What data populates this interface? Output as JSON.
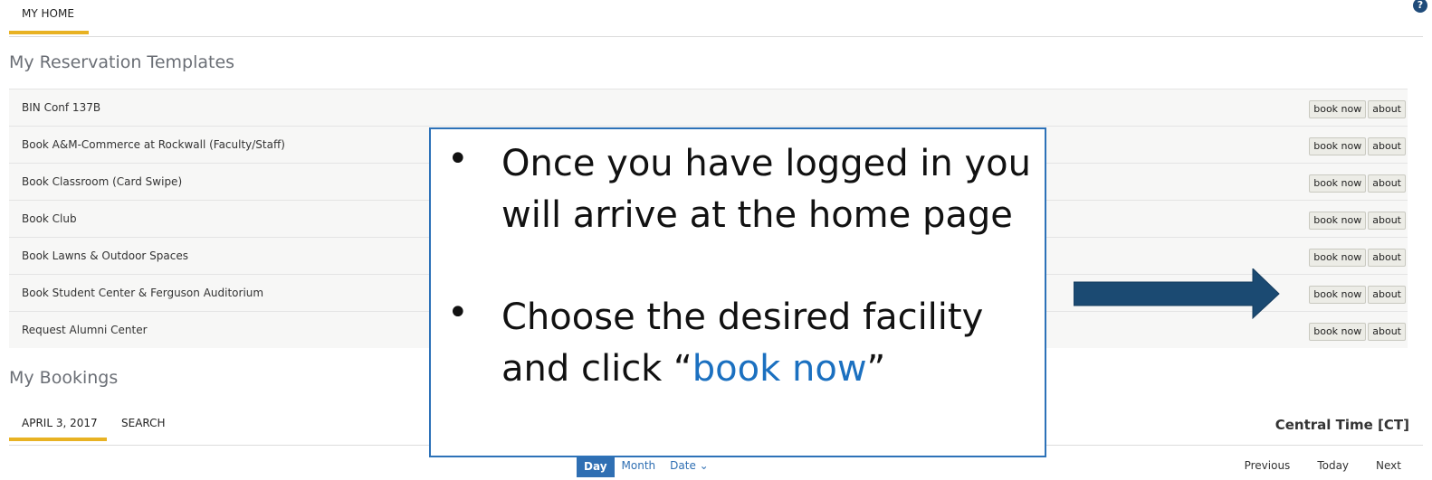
{
  "tabs": {
    "home": "MY HOME"
  },
  "help_icon": "question-circle-icon",
  "templates": {
    "title": "My Reservation Templates",
    "rows": [
      {
        "name": "BIN Conf 137B",
        "book": "book now",
        "about": "about"
      },
      {
        "name": "Book A&M-Commerce at Rockwall (Faculty/Staff)",
        "book": "book now",
        "about": "about"
      },
      {
        "name": "Book Classroom (Card Swipe)",
        "book": "book now",
        "about": "about"
      },
      {
        "name": "Book Club",
        "book": "book now",
        "about": "about"
      },
      {
        "name": "Book Lawns & Outdoor Spaces",
        "book": "book now",
        "about": "about"
      },
      {
        "name": "Book Student Center & Ferguson Auditorium",
        "book": "book now",
        "about": "about"
      },
      {
        "name": "Request Alumni Center",
        "book": "book now",
        "about": "about"
      }
    ]
  },
  "bookings": {
    "title": "My Bookings",
    "tabs": {
      "date": "APRIL 3, 2017",
      "search": "SEARCH"
    },
    "timezone": "Central Time [CT]",
    "views": {
      "day": "Day",
      "month": "Month",
      "date": "Date ⌄"
    },
    "nav": {
      "previous": "Previous",
      "today": "Today",
      "next": "Next"
    }
  },
  "callout": {
    "bullet1": "Once you have logged in you will arrive at the home page",
    "bullet2_prefix": "Choose the desired facility and click “",
    "bullet2_link": "book now",
    "bullet2_suffix": "”"
  },
  "colors": {
    "accent": "#e8b223",
    "arrow": "#1b4a72",
    "link_blue": "#1b70c0"
  }
}
